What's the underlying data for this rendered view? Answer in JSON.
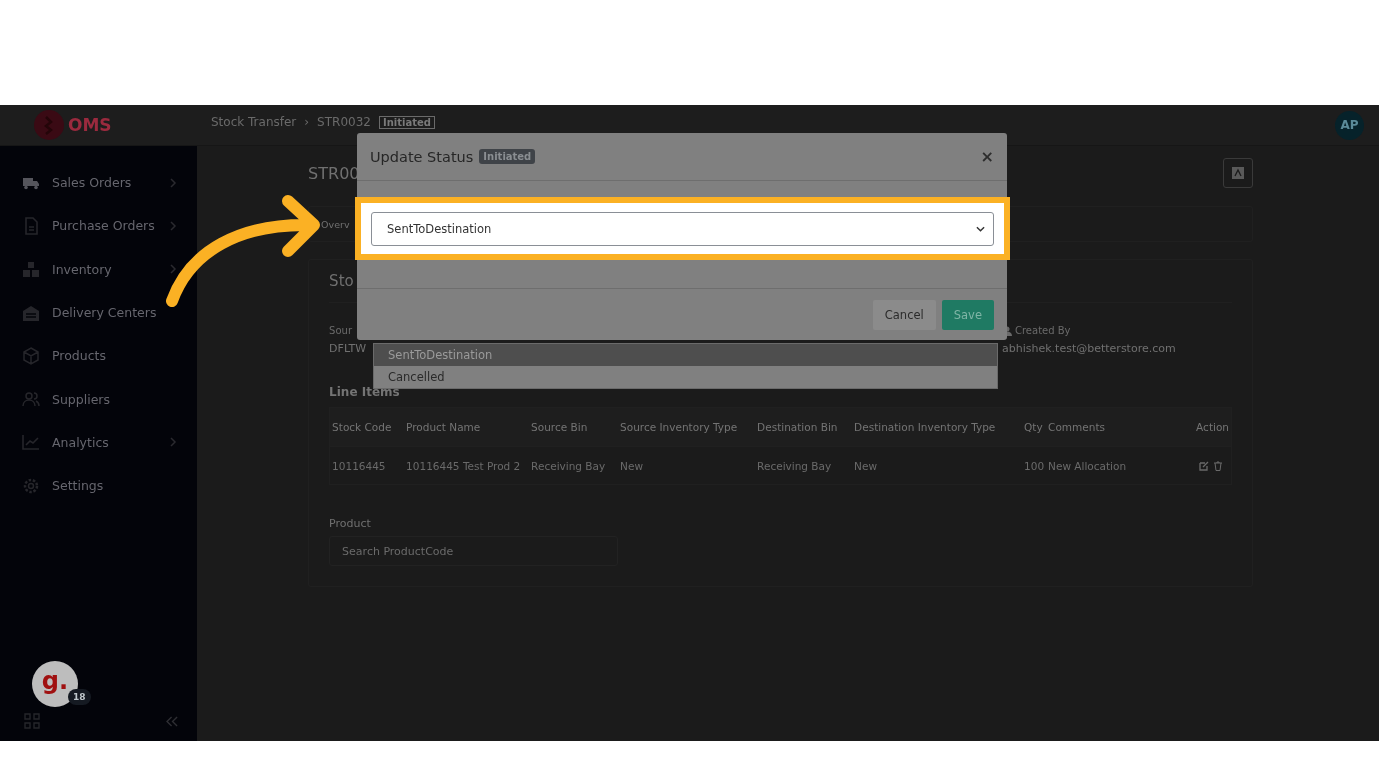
{
  "header": {
    "logo_text": "OMS",
    "breadcrumbs": [
      {
        "label": "Stock Transfer"
      },
      {
        "label": "STR0032"
      }
    ],
    "separator": "›",
    "status_badge": "Initiated",
    "avatar": "AP"
  },
  "sidebar": {
    "items": [
      {
        "label": "Sales Orders",
        "has_submenu": true
      },
      {
        "label": "Purchase Orders",
        "has_submenu": true
      },
      {
        "label": "Inventory",
        "has_submenu": true
      },
      {
        "label": "Delivery Centers",
        "has_submenu": false
      },
      {
        "label": "Products",
        "has_submenu": false
      },
      {
        "label": "Suppliers",
        "has_submenu": false
      },
      {
        "label": "Analytics",
        "has_submenu": true
      },
      {
        "label": "Settings",
        "has_submenu": false
      }
    ],
    "chat": {
      "avatar": "g.",
      "count": "18"
    }
  },
  "page": {
    "title": "STR00",
    "tab": "Overv",
    "section_title": "Sto",
    "source_label": "Sour",
    "source_value": "DFLTW",
    "created_by_label": "Created By",
    "created_by_value": "abhishek.test@betterstore.com",
    "line_items_title": "Line Items",
    "table": {
      "columns": [
        "Stock Code",
        "Product Name",
        "Source Bin",
        "Source Inventory Type",
        "Destination Bin",
        "Destination Inventory Type",
        "Qty",
        "Comments",
        "Action"
      ],
      "rows": [
        [
          "10116445",
          "10116445 Test Prod 2",
          "Receiving Bay",
          "New",
          "Receiving Bay",
          "New",
          "100",
          "New Allocation"
        ]
      ]
    },
    "product_label": "Product",
    "product_search": {
      "placeholder": "Search ProductCode"
    }
  },
  "modal": {
    "title": "Update Status",
    "status_badge": "Initiated",
    "close": "×",
    "status_select": {
      "value": "SentToDestination",
      "options": [
        {
          "label": "SentToDestination",
          "selected": true
        },
        {
          "label": "Cancelled",
          "selected": false
        }
      ]
    },
    "buttons": [
      {
        "label": "Cancel",
        "kind": "secondary"
      },
      {
        "label": "Save",
        "kind": "primary"
      }
    ]
  }
}
